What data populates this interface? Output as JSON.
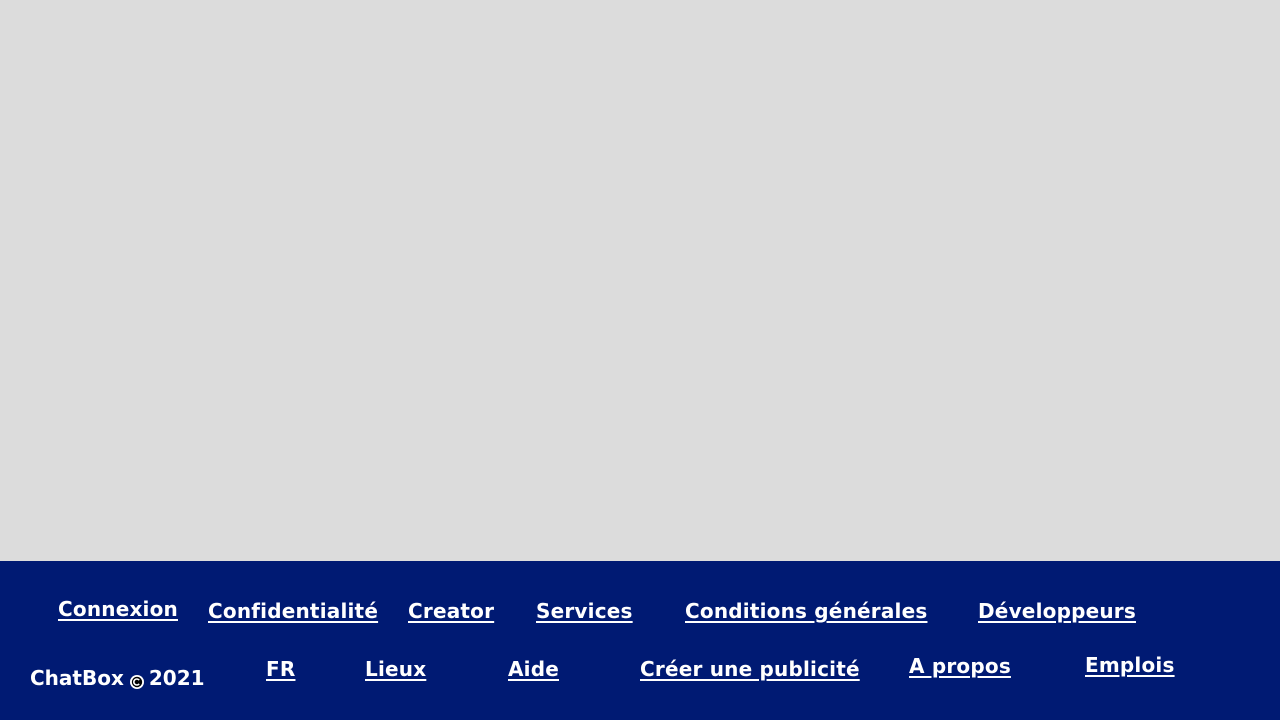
{
  "footer": {
    "links_row1": [
      {
        "id": "connexion",
        "label": "Connexion"
      },
      {
        "id": "confidentialite",
        "label": "Confidentialité"
      },
      {
        "id": "creator",
        "label": "Creator"
      },
      {
        "id": "services",
        "label": "Services"
      },
      {
        "id": "conditions",
        "label": "Conditions générales"
      },
      {
        "id": "developpeurs",
        "label": "Développeurs"
      }
    ],
    "links_row2": [
      {
        "id": "fr",
        "label": "FR"
      },
      {
        "id": "lieux",
        "label": "Lieux"
      },
      {
        "id": "aide",
        "label": "Aide"
      },
      {
        "id": "creer-pub",
        "label": "Créer une publicité"
      },
      {
        "id": "a-propos",
        "label": "A propos"
      },
      {
        "id": "emplois",
        "label": "Emplois"
      }
    ],
    "brand": {
      "name": "ChatBox",
      "icon": "copyright-icon",
      "year": "2021"
    }
  },
  "colors": {
    "page_background": "#dcdcdc",
    "footer_background": "#001a73",
    "footer_text": "#ffffff"
  }
}
